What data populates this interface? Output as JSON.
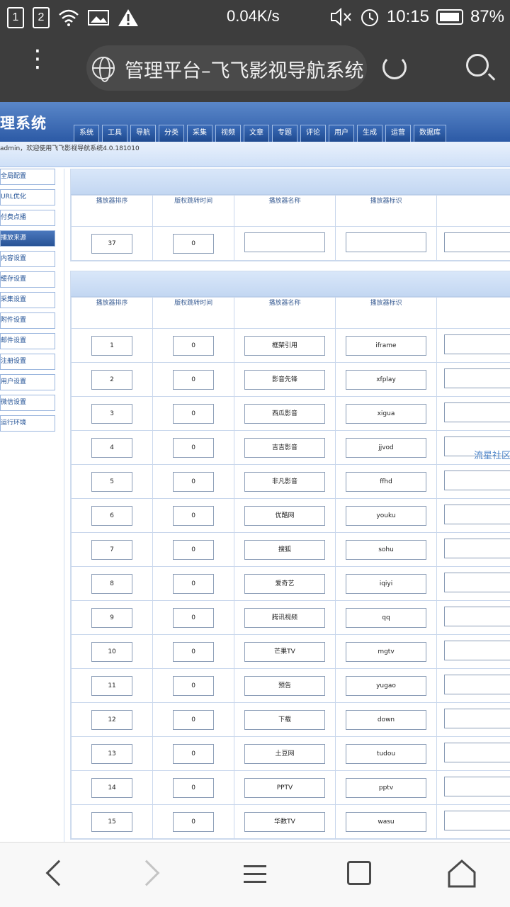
{
  "status_bar": {
    "sim1": "1",
    "sim2": "2",
    "speed": "0.04K/s",
    "time": "10:15",
    "battery": "87%"
  },
  "browser": {
    "title": "管理平台–飞飞影视导航系统"
  },
  "site": {
    "header_title": "理系统",
    "nav_tabs": [
      "系统",
      "工具",
      "导航",
      "分类",
      "采集",
      "视频",
      "文章",
      "专题",
      "评论",
      "用户",
      "生成",
      "运营",
      "数据库"
    ],
    "welcome_text": "admin，欢迎使用飞飞影视导航系统4.0.181010",
    "sidebar": [
      {
        "label": "全局配置",
        "active": false
      },
      {
        "label": "URL优化",
        "active": false
      },
      {
        "label": "付费点播",
        "active": false
      },
      {
        "label": "播放来源",
        "active": true
      },
      {
        "label": "内容设置",
        "active": false
      },
      {
        "label": "缓存设置",
        "active": false
      },
      {
        "label": "采集设置",
        "active": false
      },
      {
        "label": "附件设置",
        "active": false
      },
      {
        "label": "邮件设置",
        "active": false
      },
      {
        "label": "注册设置",
        "active": false
      },
      {
        "label": "用户设置",
        "active": false
      },
      {
        "label": "微信设置",
        "active": false
      },
      {
        "label": "运行环境",
        "active": false
      }
    ],
    "columns": [
      "播放器排序",
      "版权跳转时间",
      "播放器名称",
      "播放器标识",
      ""
    ],
    "new_row": {
      "order": "37",
      "jump": "0",
      "name": "",
      "id": "",
      "extra": ""
    },
    "rows": [
      {
        "order": "1",
        "jump": "0",
        "name": "框架引用",
        "id": "iframe"
      },
      {
        "order": "2",
        "jump": "0",
        "name": "影音先锋",
        "id": "xfplay"
      },
      {
        "order": "3",
        "jump": "0",
        "name": "西瓜影音",
        "id": "xigua"
      },
      {
        "order": "4",
        "jump": "0",
        "name": "吉吉影音",
        "id": "jjvod"
      },
      {
        "order": "5",
        "jump": "0",
        "name": "非凡影音",
        "id": "ffhd"
      },
      {
        "order": "6",
        "jump": "0",
        "name": "优酷网",
        "id": "youku"
      },
      {
        "order": "7",
        "jump": "0",
        "name": "搜狐",
        "id": "sohu"
      },
      {
        "order": "8",
        "jump": "0",
        "name": "爱奇艺",
        "id": "iqiyi"
      },
      {
        "order": "9",
        "jump": "0",
        "name": "腾讯视频",
        "id": "qq"
      },
      {
        "order": "10",
        "jump": "0",
        "name": "芒果TV",
        "id": "mgtv"
      },
      {
        "order": "11",
        "jump": "0",
        "name": "预告",
        "id": "yugao"
      },
      {
        "order": "12",
        "jump": "0",
        "name": "下载",
        "id": "down"
      },
      {
        "order": "13",
        "jump": "0",
        "name": "土豆网",
        "id": "tudou"
      },
      {
        "order": "14",
        "jump": "0",
        "name": "PPTV",
        "id": "pptv"
      },
      {
        "order": "15",
        "jump": "0",
        "name": "华数TV",
        "id": "wasu"
      }
    ],
    "watermark": "流星社区"
  }
}
